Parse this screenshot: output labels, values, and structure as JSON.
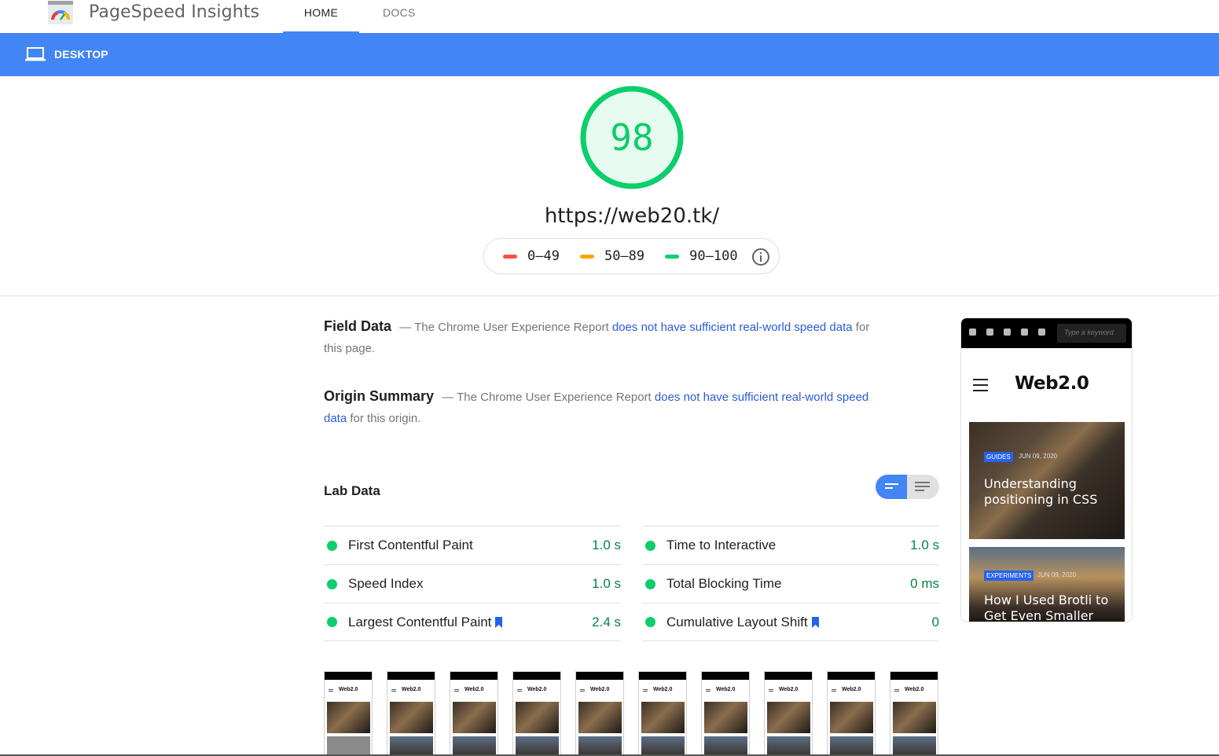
{
  "header": {
    "app_title": "PageSpeed Insights",
    "tabs": [
      {
        "label": "HOME",
        "active": true
      },
      {
        "label": "DOCS",
        "active": false
      }
    ]
  },
  "device_bar": {
    "label": "DESKTOP",
    "color": "#4285f4"
  },
  "score": {
    "value": "98",
    "url": "https://web20.tk/",
    "color": "#0cce6b"
  },
  "legend": {
    "items": [
      {
        "range": "0–49",
        "color": "#ff4e42"
      },
      {
        "range": "50–89",
        "color": "#ffa400"
      },
      {
        "range": "90–100",
        "color": "#0cce6b"
      }
    ]
  },
  "field_data": {
    "title": "Field Data",
    "prefix": "— The Chrome User Experience Report ",
    "link": "does not have sufficient real-world speed data",
    "suffix": " for this page."
  },
  "origin_summary": {
    "title": "Origin Summary",
    "prefix": "— The Chrome User Experience Report ",
    "link": "does not have sufficient real-world speed data",
    "suffix": " for this origin."
  },
  "lab_data": {
    "title": "Lab Data",
    "left": [
      {
        "label": "First Contentful Paint",
        "value": "1.0 s",
        "bookmark": false
      },
      {
        "label": "Speed Index",
        "value": "1.0 s",
        "bookmark": false
      },
      {
        "label": "Largest Contentful Paint",
        "value": "2.4 s",
        "bookmark": true
      }
    ],
    "right": [
      {
        "label": "Time to Interactive",
        "value": "1.0 s",
        "bookmark": false
      },
      {
        "label": "Total Blocking Time",
        "value": "0 ms",
        "bookmark": false
      },
      {
        "label": "Cumulative Layout Shift",
        "value": "0",
        "bookmark": true
      }
    ]
  },
  "screenshot": {
    "search_placeholder": "Type a keyword",
    "brand": "Web2.0",
    "cards": [
      {
        "tag": "GUIDES",
        "date": "JUN 09, 2020",
        "title": "Understanding positioning in CSS"
      },
      {
        "tag": "EXPERIMENTS",
        "date": "JUN 09, 2020",
        "title": "How I Used Brotli to Get Even Smaller"
      }
    ]
  },
  "filmstrip": {
    "brand": "Web2.0",
    "frames": 10
  }
}
